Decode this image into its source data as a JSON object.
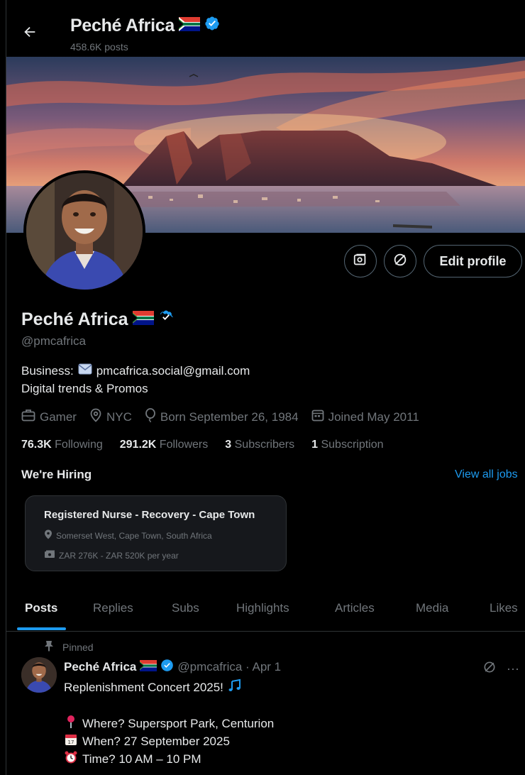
{
  "header": {
    "name": "Peché Africa",
    "posts_count": "458.6K posts"
  },
  "profile": {
    "name": "Peché Africa",
    "handle": "@pmcafrica",
    "bio_label": "Business:",
    "bio_email": "pmcafrica.social@gmail.com",
    "bio_line2": "Digital trends & Promos",
    "category": "Gamer",
    "location": "NYC",
    "born": "Born September 26, 1984",
    "joined": "Joined May 2011",
    "edit_button": "Edit profile"
  },
  "stats": {
    "following_count": "76.3K",
    "following_label": "Following",
    "followers_count": "291.2K",
    "followers_label": "Followers",
    "subscribers_count": "3",
    "subscribers_label": "Subscribers",
    "subscription_count": "1",
    "subscription_label": "Subscription"
  },
  "hiring": {
    "heading": "We're Hiring",
    "view_all": "View all jobs",
    "job": {
      "title": "Registered Nurse - Recovery - Cape Town",
      "location": "Somerset West, Cape Town, South Africa",
      "salary": "ZAR 276K - ZAR 520K per year"
    }
  },
  "tabs": [
    "Posts",
    "Replies",
    "Subs",
    "Highlights",
    "Articles",
    "Media",
    "Likes"
  ],
  "post": {
    "pinned_label": "Pinned",
    "author": "Peché Africa",
    "handle_date": "@pmcafrica · Apr 1",
    "line1": "Replenishment Concert 2025!",
    "where": "Where? Supersport Park, Centurion",
    "when": "When? 27 September 2025",
    "time": "Time? 10 AM – 10 PM",
    "more": "···"
  },
  "colors": {
    "accent": "#1d9bf0",
    "background": "#000000",
    "muted": "#71767b",
    "border": "#2f3336"
  },
  "icons": [
    "back-arrow-icon",
    "verified-badge-icon",
    "south-africa-flag-icon",
    "grok-icon",
    "ban-icon",
    "envelope-icon",
    "briefcase-icon",
    "location-pin-icon",
    "balloon-icon",
    "calendar-icon",
    "pin-icon",
    "music-notes-icon",
    "pushpin-emoji-icon",
    "calendar-emoji-icon",
    "alarm-clock-emoji-icon",
    "more-icon"
  ]
}
